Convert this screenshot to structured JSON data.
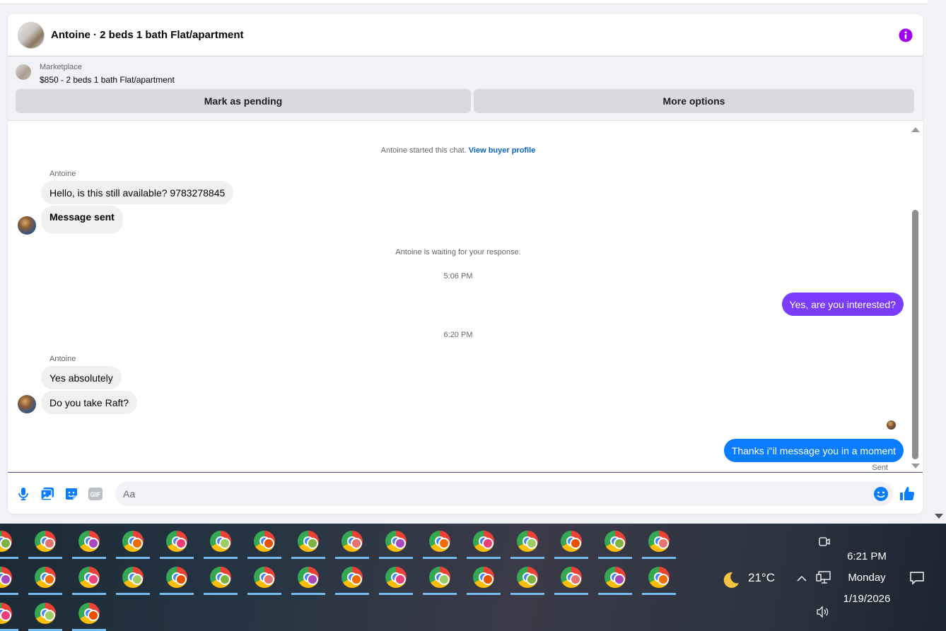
{
  "header": {
    "title": "Antoine · 2 beds 1 bath Flat/apartment",
    "info_icon": "info-icon",
    "accent": "#a100f2"
  },
  "listing": {
    "category": "Marketplace",
    "price_title": "$850 - 2 beds 1 bath Flat/apartment",
    "pending_label": "Mark as pending",
    "more_label": "More options"
  },
  "conversation": {
    "started_text": "Antoine started this chat.",
    "profile_link": "View buyer profile",
    "sender_name_1": "Antoine",
    "msg_1": "Hello, is this still available? 9783278845",
    "msg_2": "Message sent",
    "waiting_text": "Antoine is waiting for your response.",
    "time_1": "5:06 PM",
    "out_msg_1": "Yes, are you interested?",
    "time_2": "6:20 PM",
    "sender_name_2": "Antoine",
    "msg_3": "Yes absolutely",
    "msg_4": "Do you take Raft?",
    "out_msg_2": "Thanks i\"il message you in a moment",
    "status": "Sent"
  },
  "composer": {
    "placeholder": "Aa",
    "icons": [
      "microphone-icon",
      "photo-icon",
      "sticker-icon",
      "gif-icon",
      "emoji-icon",
      "thumbs-up-icon"
    ],
    "gif_label": "GIF"
  },
  "taskbar": {
    "app_icon": "chrome-profile-icon",
    "weather_icon": "moon-icon",
    "temperature": "21°C",
    "time": "6:21 PM",
    "day": "Monday",
    "date": "1/19/2026"
  }
}
